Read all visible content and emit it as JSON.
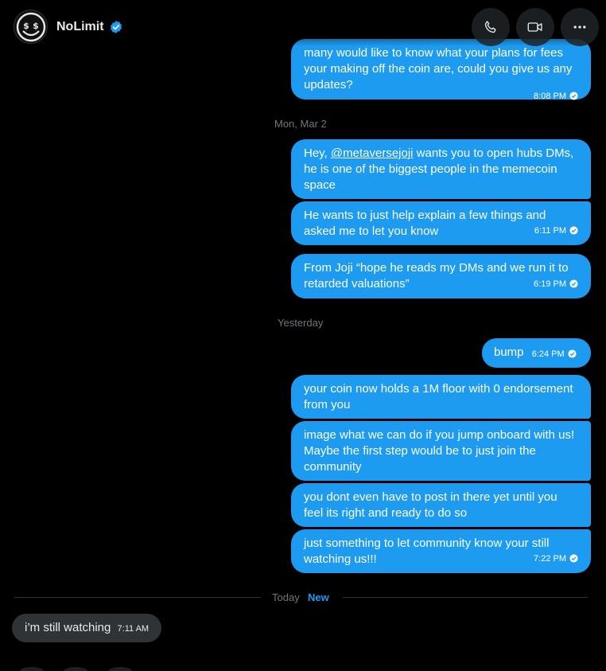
{
  "header": {
    "name": "NoLimit",
    "verified_icon": "verified-badge-icon",
    "actions": [
      {
        "label": "Call",
        "icon": "phone-icon"
      },
      {
        "label": "Video call",
        "icon": "video-icon"
      },
      {
        "label": "More",
        "icon": "more-horizontal-icon"
      }
    ]
  },
  "conversation": {
    "m1": {
      "text": "many would like to know what your plans for fees your making off the coin are, could you give us any updates?",
      "time": "8:08 PM"
    },
    "date_mar2": "Mon, Mar 2",
    "m2": {
      "pre": "Hey, ",
      "mention": "@metaversejoji",
      "post": " wants you to open hubs DMs, he is one of the biggest people in the memecoin space"
    },
    "m3": {
      "text": "He wants to just help explain a few things and asked me to let you know",
      "time": "6:11 PM"
    },
    "m4": {
      "text": "From Joji “hope he reads my DMs and we run it to retarded valuations”",
      "time": "6:19 PM"
    },
    "date_yesterday": "Yesterday",
    "m5": {
      "text": "bump",
      "time": "6:24 PM"
    },
    "m6": {
      "text": "your coin now holds a 1M floor with 0 endorsement from you"
    },
    "m7": {
      "text": "image what we can do if you jump onboard with us! Maybe the first step would be to just join the community"
    },
    "m8": {
      "text": "you dont even have to post in there yet until you feel its right and ready to do so"
    },
    "m9": {
      "text": "just something to let community know your still watching us!!!",
      "time": "7:22 PM"
    },
    "today": "Today",
    "new": "New",
    "received": {
      "text": "i’m still watching",
      "time": "7:11 AM"
    }
  },
  "colors": {
    "sent_bubble": "#1d9bf0",
    "received_bubble": "#2f3336",
    "background": "#000000",
    "accent": "#1d9bf0"
  }
}
